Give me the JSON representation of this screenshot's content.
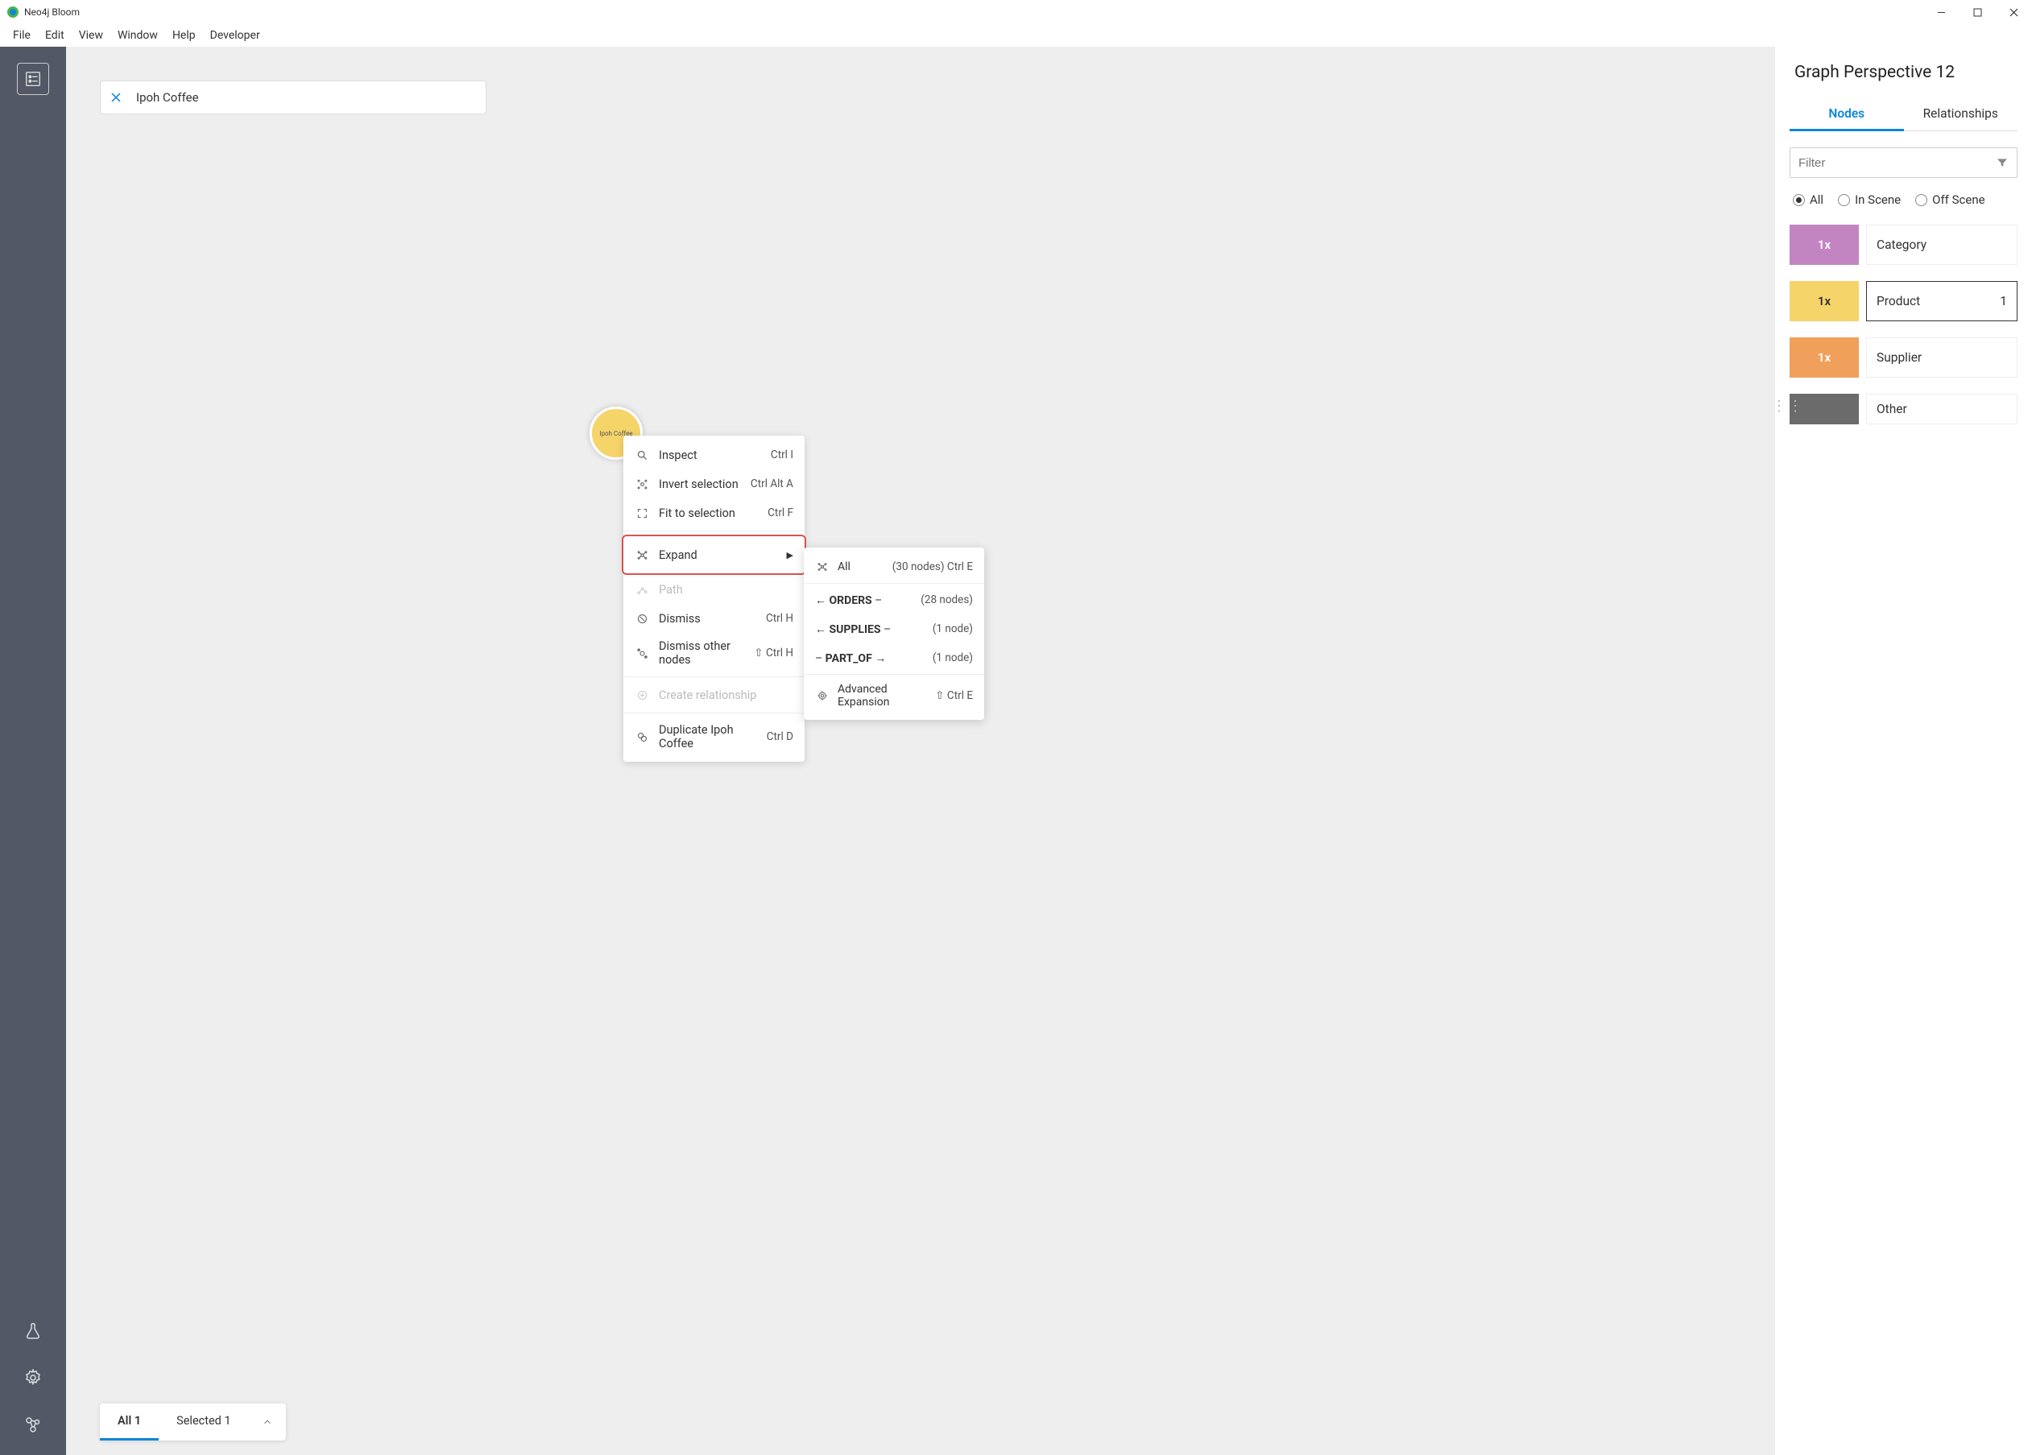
{
  "window": {
    "title": "Neo4j Bloom"
  },
  "menubar": [
    "File",
    "Edit",
    "View",
    "Window",
    "Help",
    "Developer"
  ],
  "search": {
    "query": "Ipoh Coffee"
  },
  "node": {
    "label": "Ipoh Coffee"
  },
  "context_menu": {
    "inspect": {
      "label": "Inspect",
      "shortcut": "Ctrl I"
    },
    "invert": {
      "label": "Invert selection",
      "shortcut": "Ctrl Alt A"
    },
    "fit": {
      "label": "Fit to selection",
      "shortcut": "Ctrl F"
    },
    "expand": {
      "label": "Expand"
    },
    "path": {
      "label": "Path"
    },
    "dismiss": {
      "label": "Dismiss",
      "shortcut": "Ctrl H"
    },
    "dismiss_other": {
      "label": "Dismiss other nodes",
      "shortcut": "⇧ Ctrl H"
    },
    "create_rel": {
      "label": "Create relationship"
    },
    "duplicate": {
      "label": "Duplicate Ipoh Coffee",
      "shortcut": "Ctrl D"
    }
  },
  "expand_submenu": {
    "all": {
      "label": "All",
      "count": "(30 nodes)",
      "shortcut": "Ctrl E"
    },
    "orders": {
      "arrow": "←",
      "rel": "ORDERS",
      "dash": "–",
      "count": "(28 nodes)"
    },
    "supplies": {
      "arrow": "←",
      "rel": "SUPPLIES",
      "dash": "–",
      "count": "(1 node)"
    },
    "part_of": {
      "dash_pre": "–",
      "rel": "PART_OF",
      "arrow": "→",
      "count": "(1 node)"
    },
    "advanced": {
      "label": "Advanced Expansion",
      "shortcut": "⇧ Ctrl E"
    }
  },
  "bottom_tabs": {
    "all": {
      "label": "All",
      "count": "1"
    },
    "selected": {
      "label": "Selected",
      "count": "1"
    }
  },
  "right_panel": {
    "title": "Graph Perspective 12",
    "tabs": {
      "nodes": "Nodes",
      "relationships": "Relationships"
    },
    "filter_placeholder": "Filter",
    "radios": {
      "all": "All",
      "in_scene": "In Scene",
      "off_scene": "Off Scene"
    },
    "categories": {
      "category": {
        "badge": "1x",
        "label": "Category"
      },
      "product": {
        "badge": "1x",
        "label": "Product",
        "count": "1"
      },
      "supplier": {
        "badge": "1x",
        "label": "Supplier"
      },
      "other": {
        "badge": "",
        "label": "Other"
      }
    }
  }
}
